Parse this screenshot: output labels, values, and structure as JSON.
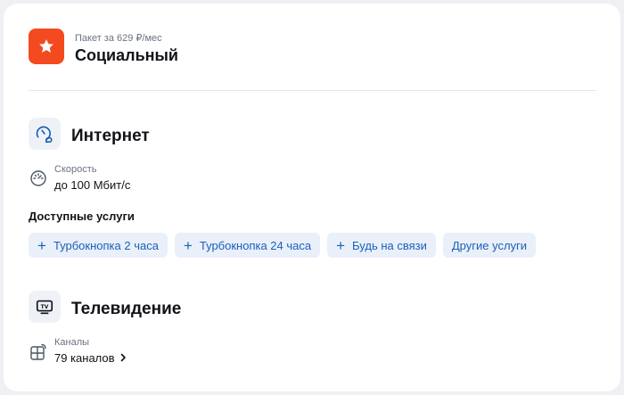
{
  "package": {
    "caption": "Пакет за 629 ₽/мес",
    "title": "Социальный",
    "icon": "star-icon",
    "accent": "#f44a1f"
  },
  "internet": {
    "title": "Интернет",
    "icon": "internet-speed-icon",
    "speed_label": "Скорость",
    "speed_value": "до 100 Мбит/с",
    "services_title": "Доступные услуги",
    "services": [
      {
        "label": "Турбокнопка 2 часа",
        "icon": "plus-icon"
      },
      {
        "label": "Турбокнопка 24 часа",
        "icon": "plus-icon"
      },
      {
        "label": "Будь на связи",
        "icon": "plus-icon"
      },
      {
        "label": "Другие услуги"
      }
    ]
  },
  "tv": {
    "title": "Телевидение",
    "icon": "tv-icon",
    "channels_label": "Каналы",
    "channels_value": "79 каналов",
    "channels_icon": "channels-grid-icon"
  },
  "colors": {
    "chip_bg": "#e9f0fa",
    "chip_text": "#1d5fb8",
    "icon_blue": "#1d5fb8"
  }
}
